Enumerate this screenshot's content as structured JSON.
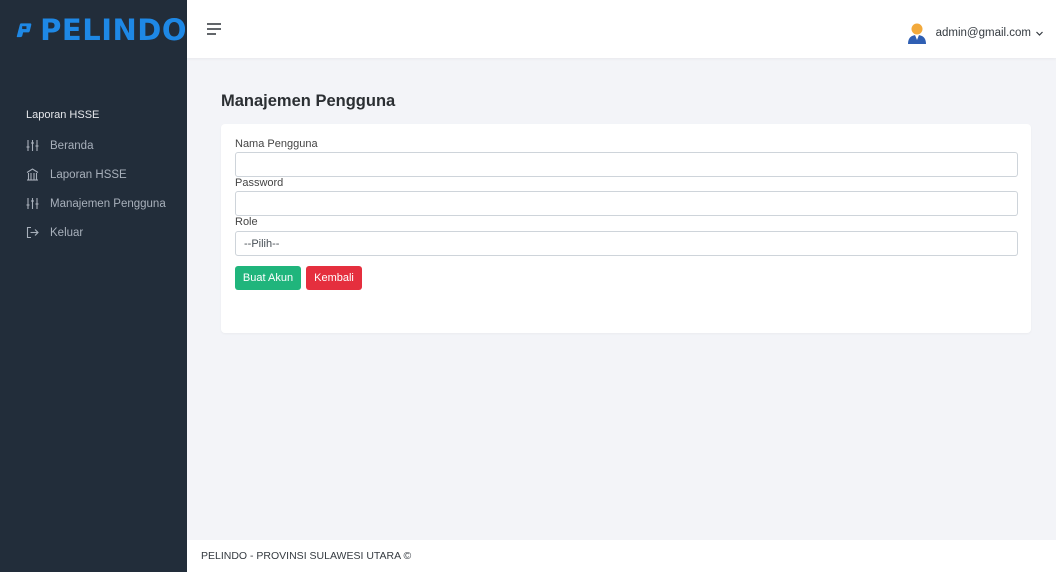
{
  "brand": {
    "name": "PELINDO",
    "color": "#1e88e5"
  },
  "sidebar": {
    "section_title": "Laporan HSSE",
    "items": [
      {
        "label": "Beranda",
        "icon": "sliders-icon"
      },
      {
        "label": "Laporan HSSE",
        "icon": "building-icon"
      },
      {
        "label": "Manajemen Pengguna",
        "icon": "sliders-icon"
      },
      {
        "label": "Keluar",
        "icon": "logout-icon"
      }
    ]
  },
  "topbar": {
    "user_email": "admin@gmail.com"
  },
  "page": {
    "title": "Manajemen Pengguna"
  },
  "form": {
    "username": {
      "label": "Nama Pengguna",
      "value": ""
    },
    "password": {
      "label": "Password",
      "value": ""
    },
    "role": {
      "label": "Role",
      "selected": "--Pilih--"
    },
    "submit_label": "Buat Akun",
    "back_label": "Kembali"
  },
  "colors": {
    "sidebar_bg": "#222d3a",
    "primary": "#20b57c",
    "danger": "#e52f3e"
  },
  "footer": {
    "text": "PELINDO - PROVINSI SULAWESI UTARA ©"
  }
}
